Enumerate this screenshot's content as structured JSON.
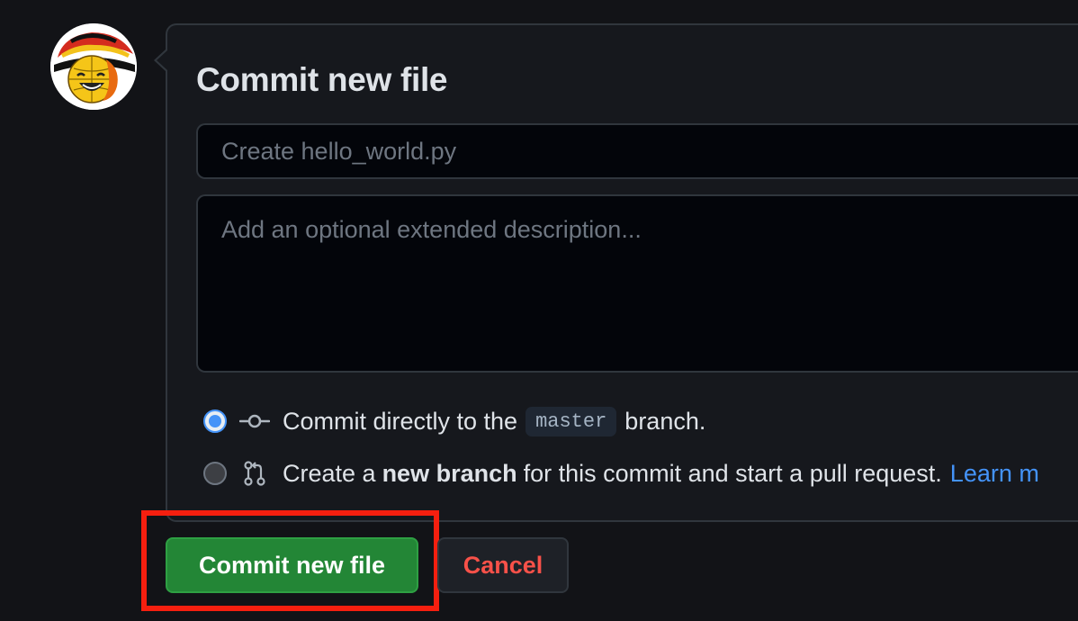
{
  "colors": {
    "page_background": "#121317",
    "panel_background": "#16181d",
    "border": "#30363d",
    "input_background": "#03050a",
    "accent_blue": "#4493f8",
    "commit_green": "#238636",
    "cancel_red": "#f85149",
    "highlight_red": "#f51f0f"
  },
  "avatar": {
    "icon": "globe-smiley-avatar"
  },
  "form": {
    "title": "Commit new file",
    "summary_placeholder": "Create hello_world.py",
    "summary_value": "",
    "description_placeholder": "Add an optional extended description...",
    "description_value": ""
  },
  "options": {
    "direct": {
      "selected": true,
      "icon": "git-commit-icon",
      "text_before": "Commit directly to the",
      "branch": "master",
      "text_after": "branch."
    },
    "new_branch": {
      "selected": false,
      "icon": "git-pull-request-icon",
      "text_before": "Create a",
      "bold": "new branch",
      "text_after": "for this commit and start a pull request.",
      "link": "Learn m"
    }
  },
  "buttons": {
    "commit_label": "Commit new file",
    "cancel_label": "Cancel",
    "commit_highlighted": true
  }
}
